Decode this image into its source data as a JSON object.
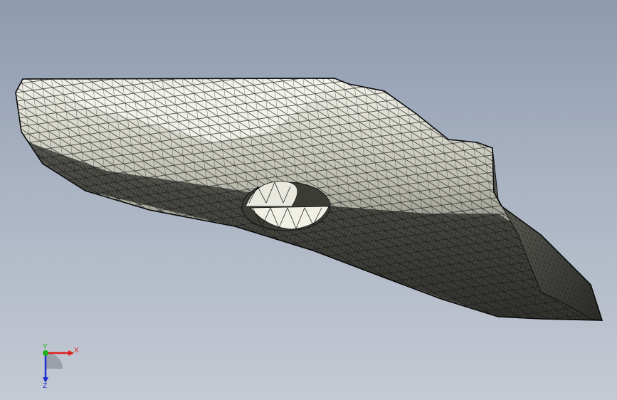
{
  "viewport": {
    "background_top": "#8e9aae",
    "background_bottom": "#c4cad3",
    "display_mode": "mesh-wireframe-shaded"
  },
  "model": {
    "fill_color": "#d8d8cc",
    "highlight_color": "#f4f4ea",
    "mesh_color": "#1a1a1a",
    "shadow_color": "#3a3a36"
  },
  "triad": {
    "x_label": "X",
    "y_label": "Y",
    "z_label": "Z",
    "x_color": "#e02020",
    "y_color": "#20b020",
    "z_color": "#2030d0"
  }
}
